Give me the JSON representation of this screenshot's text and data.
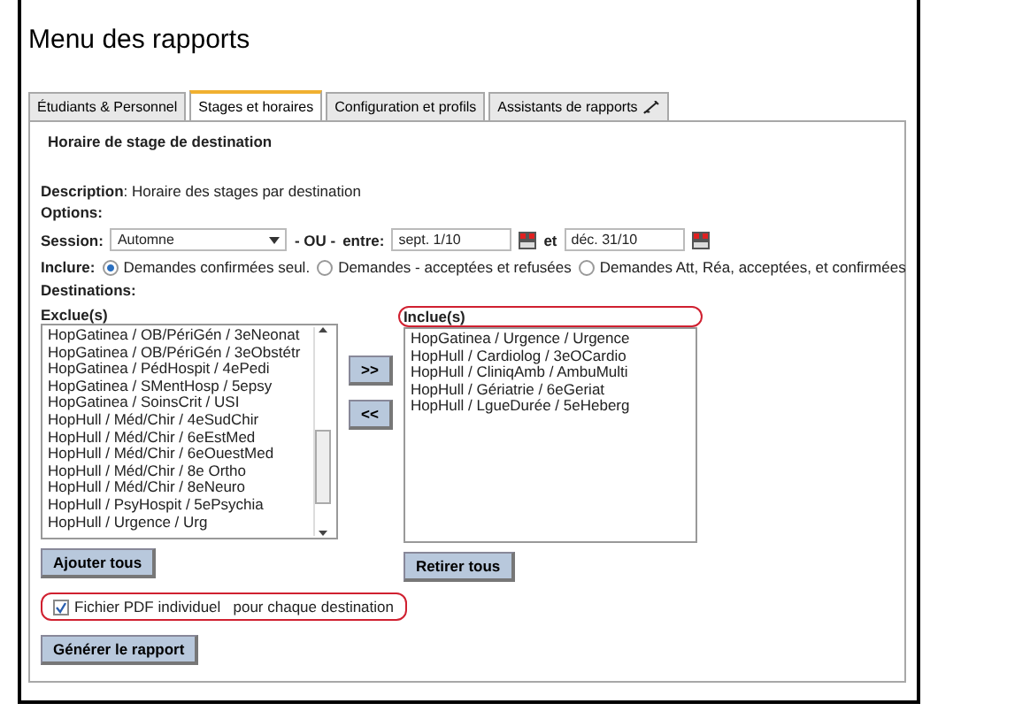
{
  "window": {
    "title": "Menu des rapports"
  },
  "tabs": [
    {
      "label": "Étudiants & Personnel",
      "selected": false
    },
    {
      "label": "Stages et horaires",
      "selected": true
    },
    {
      "label": "Configuration et profils",
      "selected": false
    },
    {
      "label": "Assistants de rapports",
      "selected": false,
      "kind": "with-icon"
    }
  ],
  "section_title": "Horaire de stage de destination",
  "description": "**Description**: Horaire des stages par destination",
  "options_label": "Options:",
  "session": {
    "label": "Session:",
    "value": "Automne",
    "or_label": "- OU -",
    "between_label": "entre:",
    "from": "sept. 1/10",
    "and_label": "et",
    "to": "déc. 31/10"
  },
  "include": {
    "label": "Inclure:",
    "options": [
      {
        "label": "Demandes confirmées seul.",
        "selected": true
      },
      {
        "label": "Demandes - acceptées et refusées",
        "selected": false
      },
      {
        "label": "Demandes Att, Réa, acceptées, et confirmées",
        "selected": false
      }
    ]
  },
  "destinations_label": "Destinations:",
  "excluded": {
    "label": "Exclue(s)",
    "items": [
      "HopGatinea / OB/PériGén / 3eNeonat",
      "HopGatinea / OB/PériGén / 3eObstétr",
      "HopGatinea / PédHospit / 4ePedi",
      "HopGatinea / SMentHosp / 5epsy",
      "HopGatinea / SoinsCrit / USI",
      "HopHull / Méd/Chir / 4eSudChir",
      "HopHull / Méd/Chir / 6eEstMed",
      "HopHull / Méd/Chir / 6eOuestMed",
      "HopHull / Méd/Chir / 8e Ortho",
      "HopHull / Méd/Chir / 8eNeuro",
      "HopHull / PsyHospit / 5ePsychia",
      "HopHull / Urgence / Urg"
    ],
    "button": "Ajouter tous"
  },
  "move_buttons": [
    ">>",
    "<<"
  ],
  "included": {
    "label": "Inclue(s)",
    "highlighted": true,
    "items": [
      "HopGatinea / Urgence / Urgence",
      "HopHull / Cardiolog / 3eOCardio",
      "HopHull / CliniqAmb / AmbuMulti",
      "HopHull / Gériatrie / 6eGeriat",
      "HopHull / LgueDurée / 5eHeberg"
    ],
    "button": "Retirer tous"
  },
  "pdf_option": {
    "label": "Fichier PDF individuel   pour chaque destination",
    "checked": true,
    "highlighted": true
  },
  "generate_button": "Générer le rapport"
}
